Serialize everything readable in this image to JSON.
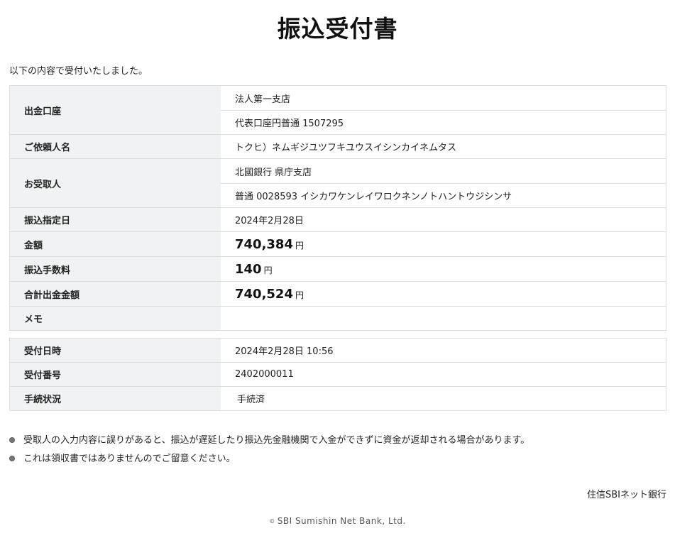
{
  "title": "振込受付書",
  "intro": "以下の内容で受付いたしました。",
  "transfer": {
    "withdrawal_account": {
      "label": "出金口座",
      "branch": "法人第一支店",
      "account": "代表口座円普通 1507295"
    },
    "requester": {
      "label": "ご依頼人名",
      "value": "トクヒ）ネムギジユツフキユウスイシンカイネムタス"
    },
    "recipient": {
      "label": "お受取人",
      "bank": "北國銀行 県庁支店",
      "account": "普通 0028593 イシカワケンレイワロクネンノトハントウジシンサ"
    },
    "date": {
      "label": "振込指定日",
      "value": "2024年2月28日"
    },
    "amount": {
      "label": "金額",
      "value": "740,384",
      "unit": "円"
    },
    "fee": {
      "label": "振込手数料",
      "value": "140",
      "unit": "円"
    },
    "total": {
      "label": "合計出金金額",
      "value": "740,524",
      "unit": "円"
    },
    "memo": {
      "label": "メモ",
      "value": ""
    }
  },
  "receipt": {
    "datetime": {
      "label": "受付日時",
      "value": "2024年2月28日 10:56"
    },
    "number": {
      "label": "受付番号",
      "value": "2402000011"
    },
    "status": {
      "label": "手続状況",
      "value": "手続済"
    }
  },
  "notes": [
    "受取人の入力内容に誤りがあると、振込が遅延したり振込先金融機関で入金ができずに資金が返却される場合があります。",
    "これは領収書ではありませんのでご留意ください。"
  ],
  "bank_name": "住信SBIネット銀行",
  "copyright": "SBI Sumishin Net Bank, Ltd."
}
